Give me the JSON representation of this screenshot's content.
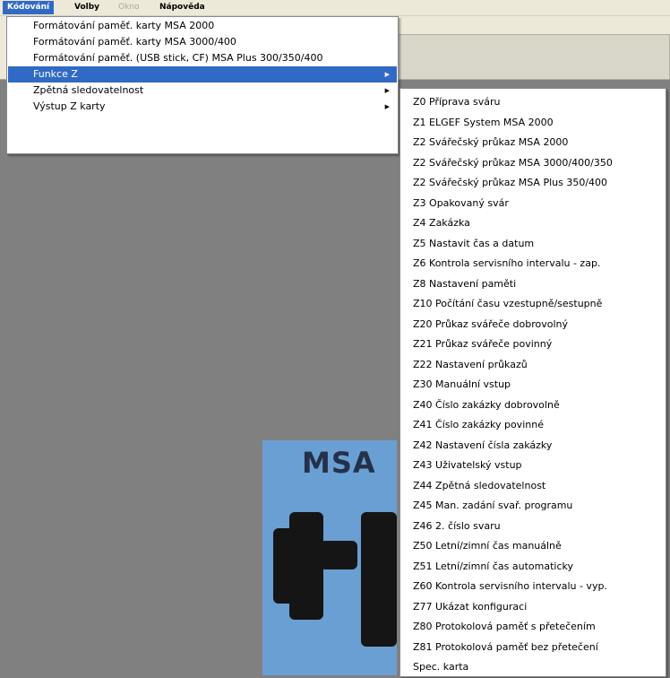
{
  "menubar": {
    "items": [
      {
        "label": "Kódování",
        "state": "active"
      },
      {
        "label": "Volby",
        "state": "normal"
      },
      {
        "label": "Okno",
        "state": "disabled"
      },
      {
        "label": "Nápověda",
        "state": "normal"
      }
    ]
  },
  "main_menu": {
    "items": [
      {
        "label": "Formátování paměť. karty MSA 2000",
        "has_submenu": false
      },
      {
        "label": "Formátování paměť. karty MSA 3000/400",
        "has_submenu": false
      },
      {
        "label": "Formátování paměť. (USB stick, CF) MSA Plus 300/350/400",
        "has_submenu": false
      },
      {
        "label": "Funkce Z",
        "has_submenu": true,
        "selected": true
      },
      {
        "label": "Zpětná sledovatelnost",
        "has_submenu": true
      },
      {
        "label": "Výstup Z karty",
        "has_submenu": true
      }
    ]
  },
  "submenu": {
    "items": [
      "Z0  Příprava sváru",
      "Z1  ELGEF System MSA 2000",
      "Z2  Svářečský průkaz MSA 2000",
      "Z2  Svářečský průkaz MSA 3000/400/350",
      "Z2  Svářečský průkaz MSA Plus 350/400",
      "Z3  Opakovaný svár",
      "Z4  Zakázka",
      "Z5  Nastavit čas a datum",
      "Z6  Kontrola servisního intervalu - zap.",
      "Z8  Nastavení paměti",
      "Z10 Počítání času vzestupně/sestupně",
      "Z20 Průkaz svářeče dobrovolný",
      "Z21 Průkaz svářeče povinný",
      "Z22 Nastavení průkazů",
      "Z30 Manuální vstup",
      "Z40 Číslo zakázky dobrovolně",
      "Z41 Číslo zakázky povinné",
      "Z42 Nastavení čísla zakázky",
      "Z43 Uživatelský vstup",
      "Z44 Zpětná sledovatelnost",
      "Z45 Man. zadání svař. programu",
      "Z46 2. číslo svaru",
      "Z50 Letní/zimní čas manuálně",
      "Z51 Letní/zimní čas automaticky",
      "Z60 Kontrola servisního intervalu - vyp.",
      "Z77 Ukázat konfiguraci",
      "Z80 Protokolová paměť s přetečením",
      "Z81 Protokolová paměť bez přetečení",
      "Spec. karta"
    ]
  },
  "background_image": {
    "title": "MSA"
  },
  "colors": {
    "selection": "#316ac5",
    "workspace": "#808080",
    "menu_bg": "#ffffff",
    "chrome": "#ece9d8"
  }
}
